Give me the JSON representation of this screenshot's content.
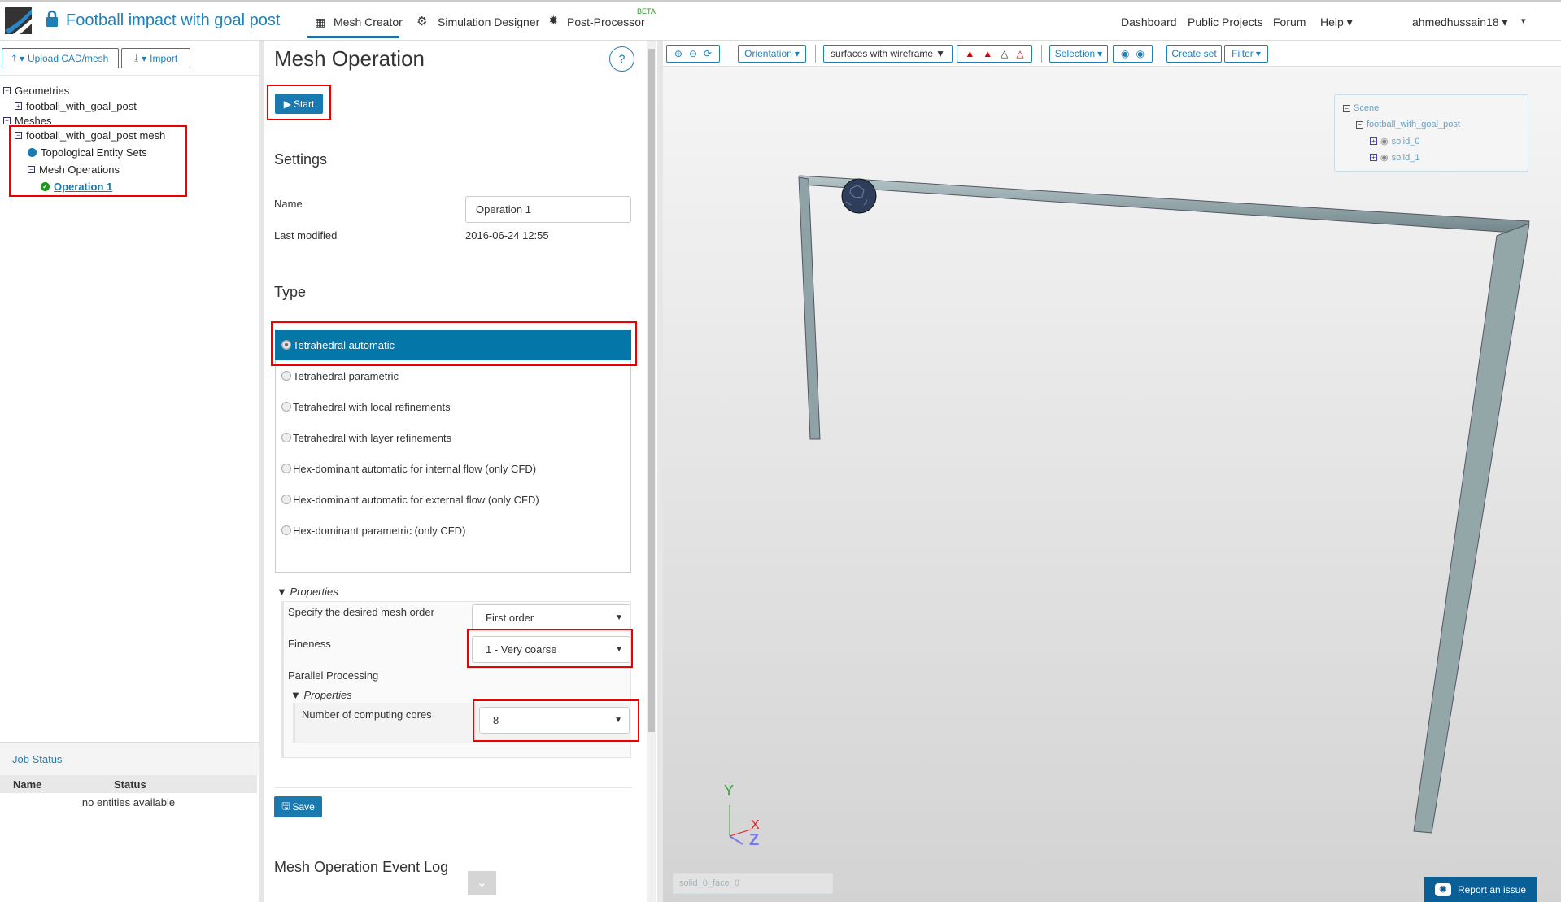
{
  "header": {
    "project_title": "Football impact with goal post",
    "tabs": [
      {
        "label": "Mesh Creator",
        "active": true
      },
      {
        "label": "Simulation Designer"
      },
      {
        "label": "Post-Processor",
        "badge": "BETA"
      }
    ],
    "links": [
      "Dashboard",
      "Public Projects",
      "Forum",
      "Help"
    ],
    "user": "ahmedhussain18"
  },
  "sidebar": {
    "upload_label": "Upload CAD/mesh",
    "import_label": "Import",
    "tree": {
      "geometries": "Geometries",
      "geometry": "football_with_goal_post",
      "meshes": "Meshes",
      "mesh": "football_with_goal_post mesh",
      "topo_sets": "Topological Entity Sets",
      "mesh_ops": "Mesh Operations",
      "operation": "Operation 1"
    }
  },
  "job_status": {
    "title": "Job Status",
    "columns": [
      "Name",
      "Status"
    ],
    "empty": "no entities available"
  },
  "panel": {
    "title": "Mesh Operation",
    "help": "?",
    "start_label": "Start",
    "settings_heading": "Settings",
    "name_label": "Name",
    "name_value": "Operation 1",
    "last_modified_label": "Last modified",
    "last_modified_value": "2016-06-24 12:55",
    "type_heading": "Type",
    "types": [
      "Tetrahedral automatic",
      "Tetrahedral parametric",
      "Tetrahedral with local refinements",
      "Tetrahedral with layer refinements",
      "Hex-dominant automatic for internal flow (only CFD)",
      "Hex-dominant automatic for external flow (only CFD)",
      "Hex-dominant parametric (only CFD)"
    ],
    "properties_label": "Properties",
    "mesh_order_label": "Specify the desired mesh order",
    "mesh_order_value": "First order",
    "fineness_label": "Fineness",
    "fineness_value": "1 - Very coarse",
    "parallel_label": "Parallel Processing",
    "inner_properties_label": "Properties",
    "cores_label": "Number of computing cores",
    "cores_value": "8",
    "save_label": "Save",
    "event_log_heading": "Mesh Operation Event Log"
  },
  "toolbar": {
    "orientation": "Orientation",
    "render_mode": "surfaces with wireframe",
    "selection": "Selection",
    "create_set": "Create set",
    "filter": "Filter"
  },
  "scene": {
    "root": "Scene",
    "model": "football_with_goal_post",
    "solids": [
      "solid_0",
      "solid_1"
    ]
  },
  "viewport": {
    "axes": {
      "x": "X",
      "y": "Y",
      "z": "Z"
    },
    "status_value": "solid_0_face_0",
    "report_label": "Report an issue"
  },
  "colors": {
    "accent": "#1a7ab0",
    "highlight": "#e00000",
    "post": "#93a6a8"
  }
}
